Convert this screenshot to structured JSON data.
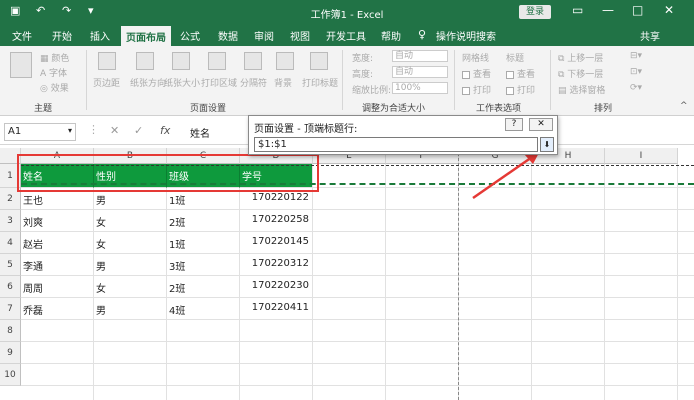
{
  "titlebar": {
    "title": "工作簿1 - Excel",
    "login": "登录",
    "undo_glyph": "↶",
    "redo_glyph": "↷",
    "save_glyph": "▣"
  },
  "tabs": [
    "文件",
    "开始",
    "插入",
    "页面布局",
    "公式",
    "数据",
    "审阅",
    "视图",
    "开发工具",
    "帮助"
  ],
  "active_tab": "页面布局",
  "tell_me": "操作说明搜索",
  "share": "共享",
  "ribbon": {
    "theme": {
      "colors": "颜色",
      "fonts": "字体",
      "effects": "效果",
      "group": "主题"
    },
    "page_setup": {
      "items": [
        "页边距",
        "纸张方向",
        "纸张大小",
        "打印区域",
        "分隔符",
        "背景",
        "打印标题"
      ],
      "group": "页面设置"
    },
    "scale": {
      "width_label": "宽度:",
      "width_val": "自动",
      "height_label": "高度:",
      "height_val": "自动",
      "scale_label": "缩放比例:",
      "scale_val": "100%",
      "group": "调整为合适大小"
    },
    "sheet_opts": {
      "gridlines": "网格线",
      "headings": "标题",
      "view1": "查看",
      "view2": "查看",
      "print1": "打印",
      "print2": "打印",
      "group": "工作表选项"
    },
    "arrange": {
      "forward": "上移一层",
      "backward": "下移一层",
      "pane": "选择窗格",
      "group": "排列"
    }
  },
  "formula": {
    "name_box": "A1",
    "value": "姓名",
    "fx": "fx"
  },
  "dialog": {
    "title": "页面设置 - 顶端标题行:",
    "input": "$1:$1",
    "help": "?",
    "close": "✕"
  },
  "columns": [
    "A",
    "B",
    "C",
    "D",
    "E",
    "F",
    "G",
    "H",
    "I"
  ],
  "rows": [
    "1",
    "2",
    "3",
    "4",
    "5",
    "6",
    "7",
    "8",
    "9",
    "10"
  ],
  "cells": [
    [
      "姓名",
      "性别",
      "班级",
      "学号"
    ],
    [
      "王也",
      "男",
      "1班",
      "170220122"
    ],
    [
      "刘爽",
      "女",
      "2班",
      "170220258"
    ],
    [
      "赵岩",
      "女",
      "1班",
      "170220145"
    ],
    [
      "李通",
      "男",
      "3班",
      "170220312"
    ],
    [
      "周周",
      "女",
      "2班",
      "170220230"
    ],
    [
      "乔磊",
      "男",
      "4班",
      "170220411"
    ]
  ],
  "colors": {
    "excel_green": "#217346",
    "header_fill": "#0e9a3d",
    "annotation_red": "#e53935"
  }
}
